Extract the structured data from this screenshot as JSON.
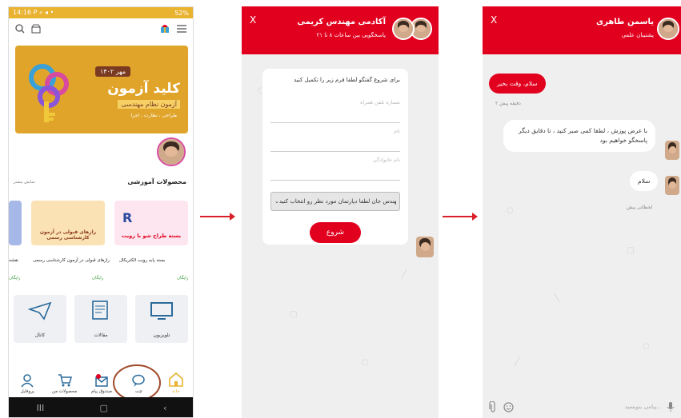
{
  "panel1": {
    "status_time": "14:16",
    "status_icons_left": "P ⌕ ◂ •",
    "status_battery": "52%",
    "banner": {
      "tag": "مهر ۱۴۰۲",
      "title": "کلید آزمون",
      "subtitle": "آزمون نظام مهندسی",
      "sub2": "طراحی ، نظارت ، اجرا"
    },
    "section_title": "محصولات آموزشی",
    "section_more": "نمایش بیشتر",
    "products": [
      {
        "title": "بسته پایه رویت الکتریکال",
        "price": "رایگان"
      },
      {
        "title": "رازهای قبولی در آزمون کارشناسی رسمی",
        "price": "رایگان"
      },
      {
        "title": "نقشه",
        "price": "رایگان"
      }
    ],
    "card_red_text": "بسته طراح شو با رویت",
    "card_yellow_text": "رازهای قبولی در آزمون کارشناسی رسمی",
    "grid": [
      {
        "label": "تلویزیون",
        "icon": "tv-icon"
      },
      {
        "label": "مقالات",
        "icon": "article-icon"
      },
      {
        "label": "کانال",
        "icon": "paper-plane-icon"
      }
    ],
    "nav": [
      {
        "label": "خانه",
        "icon": "home-icon"
      },
      {
        "label": "چت",
        "icon": "chat-icon"
      },
      {
        "label": "صندوق پیام",
        "icon": "mailbox-icon"
      },
      {
        "label": "محصولات من",
        "icon": "cart-icon"
      },
      {
        "label": "پروفایل",
        "icon": "profile-icon"
      }
    ],
    "android": [
      "III",
      "▢",
      "‹"
    ]
  },
  "panel2": {
    "close": "X",
    "name": "آکادمی مهندس کریمی",
    "sub": "پاسخگویی بین ساعات ۸ تا ۲۱",
    "intro": "برای شروع گفتگو لطفا فرم زیر را تکمیل کنید",
    "fields": [
      "شماره تلفن همراه",
      "نام",
      "نام خانوادگی"
    ],
    "select": "مهندس جان لطفا دپارتمان مورد نظر رو انتخاب کنید",
    "start": "شروع"
  },
  "panel3": {
    "close": "X",
    "name": "یاسمن طاهری",
    "sub": "پشتیبان علمی",
    "msg1": "سلام، وقت بخیر",
    "time1": "۲ دقیقه پیش",
    "msg2": "با عرض پوزش ، لطفا کمی صبر کنید ، تا دقایق دیگر پاسخگو خواهیم بود",
    "msg3": "سلام",
    "time3": "لحظاتی پیش",
    "input_placeholder": "پیامی بنویسید..."
  },
  "colors": {
    "brand_red": "#e2001f",
    "accent_yellow": "#e9b22f"
  }
}
